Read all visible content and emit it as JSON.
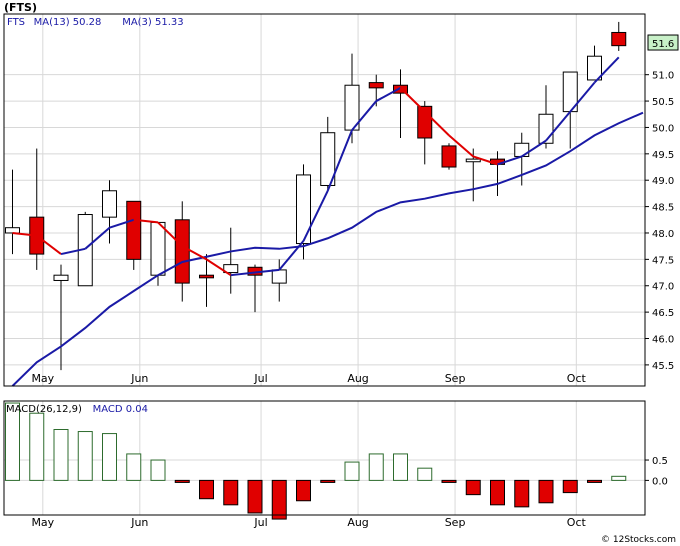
{
  "chart_data": [
    {
      "type": "candlestick",
      "title": "(FTS)",
      "legend": [
        {
          "label": "FTS",
          "color": "#1a1aa6"
        },
        {
          "label": "MA(13)",
          "value": "50.28",
          "color": "#1a1aa6"
        },
        {
          "label": "MA(3)",
          "value": "51.33",
          "color": "#1a1aa6"
        }
      ],
      "x_labels": [
        {
          "label": "May",
          "index": 1.25
        },
        {
          "label": "Jun",
          "index": 5.25
        },
        {
          "label": "Jul",
          "index": 10.25
        },
        {
          "label": "Aug",
          "index": 14.25
        },
        {
          "label": "Sep",
          "index": 18.25
        },
        {
          "label": "Oct",
          "index": 23.25
        }
      ],
      "ylim": [
        45.1,
        52.15
      ],
      "yticks": [
        45.5,
        46.0,
        46.5,
        47.0,
        47.5,
        48.0,
        48.5,
        49.0,
        49.5,
        50.0,
        50.5,
        51.0
      ],
      "last_price": "51.6",
      "candles": [
        {
          "o": 48.0,
          "h": 49.2,
          "l": 47.6,
          "c": 48.1
        },
        {
          "o": 48.3,
          "h": 49.6,
          "l": 47.3,
          "c": 47.6
        },
        {
          "o": 47.1,
          "h": 47.4,
          "l": 45.4,
          "c": 47.2
        },
        {
          "o": 47.0,
          "h": 48.4,
          "l": 47.0,
          "c": 48.35
        },
        {
          "o": 48.3,
          "h": 49.0,
          "l": 47.8,
          "c": 48.8
        },
        {
          "o": 48.6,
          "h": 48.6,
          "l": 47.3,
          "c": 47.5
        },
        {
          "o": 47.2,
          "h": 48.2,
          "l": 47.0,
          "c": 48.2
        },
        {
          "o": 48.25,
          "h": 48.6,
          "l": 46.7,
          "c": 47.05
        },
        {
          "o": 47.2,
          "h": 47.6,
          "l": 46.6,
          "c": 47.15
        },
        {
          "o": 47.25,
          "h": 48.1,
          "l": 46.85,
          "c": 47.4
        },
        {
          "o": 47.35,
          "h": 47.4,
          "l": 46.5,
          "c": 47.2
        },
        {
          "o": 47.05,
          "h": 47.5,
          "l": 46.7,
          "c": 47.3
        },
        {
          "o": 47.8,
          "h": 49.3,
          "l": 47.5,
          "c": 49.1
        },
        {
          "o": 48.9,
          "h": 50.2,
          "l": 48.8,
          "c": 49.9
        },
        {
          "o": 49.95,
          "h": 51.4,
          "l": 49.7,
          "c": 50.8
        },
        {
          "o": 50.85,
          "h": 51.0,
          "l": 50.4,
          "c": 50.75
        },
        {
          "o": 50.8,
          "h": 51.1,
          "l": 49.8,
          "c": 50.65
        },
        {
          "o": 50.4,
          "h": 50.5,
          "l": 49.3,
          "c": 49.8
        },
        {
          "o": 49.65,
          "h": 49.7,
          "l": 49.2,
          "c": 49.25
        },
        {
          "o": 49.35,
          "h": 49.6,
          "l": 48.6,
          "c": 49.4
        },
        {
          "o": 49.4,
          "h": 49.55,
          "l": 48.7,
          "c": 49.3
        },
        {
          "o": 49.45,
          "h": 49.9,
          "l": 48.9,
          "c": 49.7
        },
        {
          "o": 49.7,
          "h": 50.8,
          "l": 49.6,
          "c": 50.25
        },
        {
          "o": 50.3,
          "h": 51.05,
          "l": 49.6,
          "c": 51.05
        },
        {
          "o": 50.9,
          "h": 51.55,
          "l": 50.9,
          "c": 51.35
        },
        {
          "o": 51.8,
          "h": 52.0,
          "l": 51.45,
          "c": 51.55
        }
      ],
      "ma13": [
        45.1,
        45.55,
        45.85,
        46.2,
        46.6,
        46.9,
        47.2,
        47.45,
        47.55,
        47.65,
        47.72,
        47.7,
        47.75,
        47.9,
        48.1,
        48.4,
        48.58,
        48.65,
        48.75,
        48.83,
        48.93,
        49.1,
        49.28,
        49.55,
        49.85,
        50.08,
        50.28
      ],
      "ma3": [
        {
          "i": 0,
          "v": 48.0
        },
        {
          "i": 1,
          "v": 47.95
        },
        {
          "i": 2,
          "v": 47.6
        },
        {
          "i": 3,
          "v": 47.7
        },
        {
          "i": 4,
          "v": 48.1
        },
        {
          "i": 5,
          "v": 48.25
        },
        {
          "i": 6,
          "v": 48.2
        },
        {
          "i": 7,
          "v": 47.75
        },
        {
          "i": 8,
          "v": 47.5
        },
        {
          "i": 9,
          "v": 47.2
        },
        {
          "i": 10,
          "v": 47.25
        },
        {
          "i": 11,
          "v": 47.3
        },
        {
          "i": 12,
          "v": 47.85
        },
        {
          "i": 13,
          "v": 48.8
        },
        {
          "i": 14,
          "v": 49.95
        },
        {
          "i": 15,
          "v": 50.5
        },
        {
          "i": 16,
          "v": 50.75
        },
        {
          "i": 17,
          "v": 50.3
        },
        {
          "i": 18,
          "v": 49.85
        },
        {
          "i": 19,
          "v": 49.45
        },
        {
          "i": 20,
          "v": 49.3
        },
        {
          "i": 21,
          "v": 49.45
        },
        {
          "i": 22,
          "v": 49.75
        },
        {
          "i": 23,
          "v": 50.3
        },
        {
          "i": 24,
          "v": 50.85
        },
        {
          "i": 25,
          "v": 51.33
        }
      ],
      "colors": {
        "up": "#ffffff",
        "down": "#e00000",
        "wick": "#000000",
        "ma13": "#1a1aa6",
        "ma3_up": "#1a1aa6",
        "ma3_down": "#e00000",
        "last_box": "#c8f0c8"
      }
    },
    {
      "type": "bar",
      "legend": [
        {
          "label": "MACD(26,12,9)",
          "color": "#000000"
        },
        {
          "label": "MACD",
          "value": "0.04",
          "color": "#1a1aa6"
        }
      ],
      "ylim": [
        -0.85,
        1.95
      ],
      "yticks": [
        {
          "value": 0.5,
          "label": "0.5"
        },
        {
          "value": 0.0,
          "label": "0.0"
        }
      ],
      "values": [
        1.9,
        1.65,
        1.25,
        1.2,
        1.15,
        0.65,
        0.5,
        -0.05,
        -0.45,
        -0.6,
        -0.8,
        -0.95,
        -0.5,
        -0.05,
        0.45,
        0.65,
        0.65,
        0.3,
        -0.05,
        -0.35,
        -0.6,
        -0.65,
        -0.55,
        -0.3,
        -0.05,
        0.1
      ],
      "colors": {
        "positive_fill": "#ffffff",
        "positive_stroke": "#2d6b2d",
        "negative_fill": "#e00000",
        "negative_stroke": "#000000"
      }
    }
  ],
  "watermark": "© 12Stocks.com"
}
